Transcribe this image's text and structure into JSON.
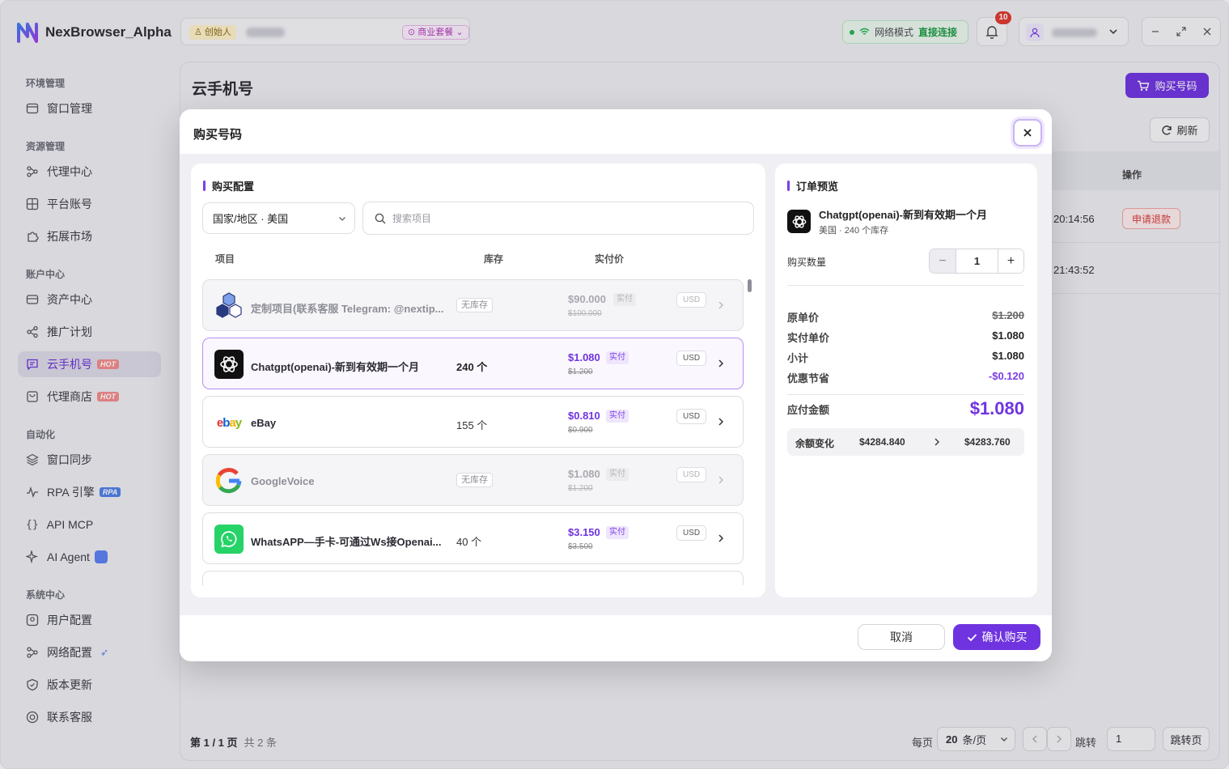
{
  "app": {
    "name": "NexBrowser_Alpha"
  },
  "header": {
    "role_badge": "创始人",
    "plan_badge": "商业套餐",
    "network_label": "网络模式",
    "network_value": "直接连接",
    "notification_count": "10"
  },
  "sidebar": {
    "sections": [
      {
        "title": "环境管理",
        "items": [
          {
            "label": "窗口管理",
            "icon": "window-icon"
          }
        ]
      },
      {
        "title": "资源管理",
        "items": [
          {
            "label": "代理中心",
            "icon": "proxy-icon"
          },
          {
            "label": "平台账号",
            "icon": "grid-icon"
          },
          {
            "label": "拓展市场",
            "icon": "puzzle-icon"
          }
        ]
      },
      {
        "title": "账户中心",
        "items": [
          {
            "label": "资产中心",
            "icon": "wallet-icon"
          },
          {
            "label": "推广计划",
            "icon": "share-icon"
          },
          {
            "label": "云手机号",
            "icon": "message-icon",
            "badge": "HOT",
            "active": true
          },
          {
            "label": "代理商店",
            "icon": "shop-icon",
            "badge": "HOT"
          }
        ]
      },
      {
        "title": "自动化",
        "items": [
          {
            "label": "窗口同步",
            "icon": "layers-icon"
          },
          {
            "label": "RPA 引擎",
            "icon": "pulse-icon",
            "badge": "RPA"
          },
          {
            "label": "API MCP",
            "icon": "braces-icon"
          },
          {
            "label": "AI Agent",
            "icon": "sparkle-icon"
          }
        ]
      },
      {
        "title": "系统中心",
        "items": [
          {
            "label": "用户配置",
            "icon": "user-config-icon"
          },
          {
            "label": "网络配置",
            "icon": "network-icon"
          },
          {
            "label": "版本更新",
            "icon": "shield-icon"
          },
          {
            "label": "联系客服",
            "icon": "support-icon"
          }
        ]
      }
    ]
  },
  "main": {
    "title": "云手机号",
    "buy_button": "购买号码",
    "refresh_button": "刷新",
    "table": {
      "col_action": "操作",
      "rows": [
        {
          "time": "20:14:56",
          "action": "申请退款"
        },
        {
          "time": "21:43:52",
          "action": ""
        }
      ]
    },
    "pagination": {
      "page_info": "第 1 / 1 页",
      "total": "共 2 条",
      "per_page_label": "每页",
      "per_page_value": "20",
      "per_page_unit": "条/页",
      "jump_label": "跳转",
      "jump_value": "1",
      "jump_button": "跳转页"
    }
  },
  "modal": {
    "title": "购买号码",
    "config_title": "购买配置",
    "country_select": "国家/地区 · 美国",
    "search_placeholder": "搜索项目",
    "col_item": "项目",
    "col_stock": "库存",
    "col_price": "实付价",
    "products": [
      {
        "name": "定制项目(联系客服 Telegram: @nextip...",
        "stock": "",
        "no_stock": "无库存",
        "price": "$90.000",
        "tag": "实付",
        "original": "$100.000",
        "currency": "USD",
        "disabled": true,
        "icon": "hexagon-logo-icon"
      },
      {
        "name": "Chatgpt(openai)-新到有效期一个月",
        "stock": "240 个",
        "no_stock": "",
        "price": "$1.080",
        "tag": "实付",
        "original": "$1.200",
        "currency": "USD",
        "selected": true,
        "icon": "openai-logo-icon"
      },
      {
        "name": "eBay",
        "stock": "155 个",
        "no_stock": "",
        "price": "$0.810",
        "tag": "实付",
        "original": "$0.900",
        "currency": "USD",
        "icon": "ebay-logo-icon"
      },
      {
        "name": "GoogleVoice",
        "stock": "",
        "no_stock": "无库存",
        "price": "$1.080",
        "tag": "实付",
        "original": "$1.200",
        "currency": "USD",
        "disabled": true,
        "icon": "google-logo-icon"
      },
      {
        "name": "WhatsAPP—手卡-可通过Ws接Openai...",
        "stock": "40 个",
        "no_stock": "",
        "price": "$3.150",
        "tag": "实付",
        "original": "$3.500",
        "currency": "USD",
        "icon": "whatsapp-logo-icon"
      }
    ],
    "order": {
      "title": "订单预览",
      "product_name": "Chatgpt(openai)-新到有效期一个月",
      "product_sub": "美国 · 240 个库存",
      "quantity_label": "购买数量",
      "quantity": "1",
      "original_unit_label": "原单价",
      "original_unit": "$1.200",
      "paid_unit_label": "实付单价",
      "paid_unit": "$1.080",
      "subtotal_label": "小计",
      "subtotal": "$1.080",
      "discount_label": "优惠节省",
      "discount": "-$0.120",
      "due_label": "应付金额",
      "due": "$1.080",
      "balance_label": "余额变化",
      "balance_before": "$4284.840",
      "balance_after": "$4283.760"
    },
    "cancel_button": "取消",
    "confirm_button": "确认购买"
  },
  "colors": {
    "accent": "#6f34df",
    "hot": "#f28b8b",
    "success": "#22b14c",
    "danger": "#d63b3b"
  }
}
